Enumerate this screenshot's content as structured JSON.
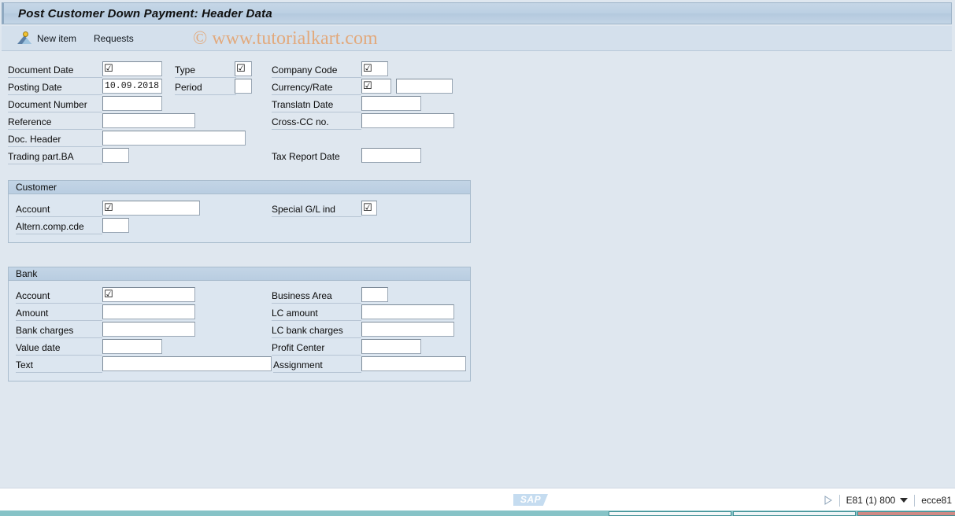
{
  "window": {
    "title": "Post Customer Down Payment: Header Data"
  },
  "toolbar": {
    "new_item_label": "New item",
    "requests_label": "Requests",
    "new_item_icon": "new-item-person-icon"
  },
  "watermark": {
    "text": "© www.tutorialkart.com",
    "color": "#e2a97c"
  },
  "header_form": {
    "left": [
      {
        "label": "Document Date",
        "value": "",
        "required": true
      },
      {
        "label": "Posting Date",
        "value": "10.09.2018",
        "required": false
      },
      {
        "label": "Document Number",
        "value": "",
        "required": false
      },
      {
        "label": "Reference",
        "value": "",
        "required": false
      },
      {
        "label": "Doc. Header",
        "value": "",
        "required": false
      },
      {
        "label": "Trading part.BA",
        "value": "",
        "required": false
      }
    ],
    "middle": [
      {
        "label": "Type",
        "value": "",
        "required": true
      },
      {
        "label": "Period",
        "value": "",
        "required": false
      }
    ],
    "right": [
      {
        "label": "Company Code",
        "value": "",
        "required": true
      },
      {
        "label": "Currency/Rate",
        "value": "",
        "required": true
      },
      {
        "label": "Translatn Date",
        "value": "",
        "required": false
      },
      {
        "label": "Cross-CC no.",
        "value": "",
        "required": false
      },
      {
        "label": "Tax Report Date",
        "value": "",
        "required": false
      }
    ],
    "rate_value": ""
  },
  "customer_group": {
    "title": "Customer",
    "fields": [
      {
        "label": "Account",
        "value": "",
        "required": true
      },
      {
        "label": "Altern.comp.cde",
        "value": "",
        "required": false
      },
      {
        "label": "Special G/L ind",
        "value": "",
        "required": true
      }
    ]
  },
  "bank_group": {
    "title": "Bank",
    "left": [
      {
        "label": "Account",
        "value": "",
        "required": true
      },
      {
        "label": "Amount",
        "value": "",
        "required": false
      },
      {
        "label": "Bank charges",
        "value": "",
        "required": false
      },
      {
        "label": "Value date",
        "value": "",
        "required": false
      },
      {
        "label": "Text",
        "value": "",
        "required": false
      }
    ],
    "right": [
      {
        "label": "Business Area",
        "value": "",
        "required": false
      },
      {
        "label": "LC amount",
        "value": "",
        "required": false
      },
      {
        "label": "LC bank charges",
        "value": "",
        "required": false
      },
      {
        "label": "Profit Center",
        "value": "",
        "required": false
      },
      {
        "label": "Assignment",
        "value": "",
        "required": false
      }
    ]
  },
  "statusbar": {
    "logo_text": "SAP",
    "system": "E81 (1) 800",
    "user": "ecce81",
    "play_icon": "play-triangle-icon",
    "dropdown_icon": "chevron-down-icon"
  },
  "required_marker_glyph": "☑"
}
